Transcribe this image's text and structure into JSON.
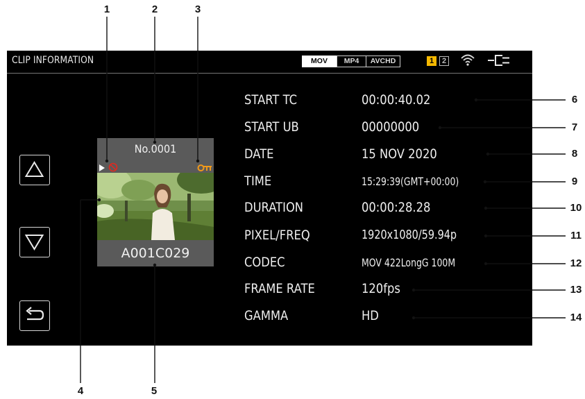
{
  "callouts": [
    "1",
    "2",
    "3",
    "4",
    "5",
    "6",
    "7",
    "8",
    "9",
    "10",
    "11",
    "12",
    "13",
    "14"
  ],
  "header": {
    "title": "CLIP INFORMATION",
    "formats": [
      "MOV",
      "MP4",
      "AVCHD"
    ],
    "active_format": "MOV",
    "slots": [
      "1",
      "2"
    ],
    "active_slot": "1",
    "icons": [
      "wifi-icon",
      "power-plug-icon"
    ],
    "slot_accent": "#f5b800"
  },
  "thumbnail": {
    "clip_number": "No.0001",
    "clip_name": "A001C029",
    "status_icons": [
      "play-triangle-icon",
      "prohibited-icon",
      "protect-key-icon"
    ],
    "prohibit_color": "#e0291f",
    "key_color": "#f29a1a"
  },
  "navigation": {
    "buttons": [
      "up-button",
      "down-button",
      "back-button"
    ]
  },
  "info_rows": [
    {
      "label": "START TC",
      "value": "00:00:40.02"
    },
    {
      "label": "START UB",
      "value": "00000000"
    },
    {
      "label": "DATE",
      "value": "15 NOV 2020"
    },
    {
      "label": "TIME",
      "value": "15:29:39(GMT+00:00)"
    },
    {
      "label": "DURATION",
      "value": "00:00:28.28"
    },
    {
      "label": "PIXEL/FREQ",
      "value": "1920x1080/59.94p"
    },
    {
      "label": "CODEC",
      "value": "MOV 422LongG 100M"
    },
    {
      "label": "FRAME RATE",
      "value": "120fps"
    },
    {
      "label": "GAMMA",
      "value": "HD"
    }
  ]
}
